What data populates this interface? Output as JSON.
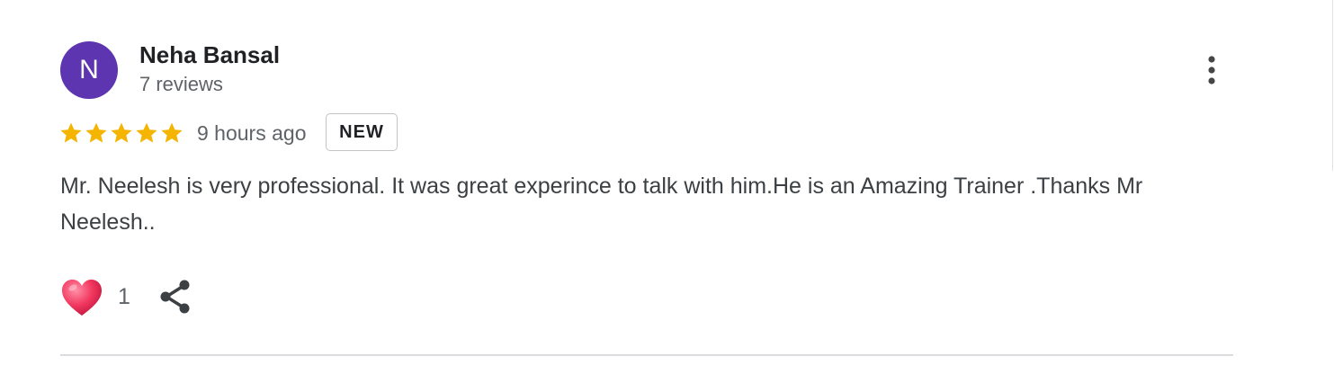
{
  "review": {
    "author": {
      "initial": "N",
      "name": "Neha Bansal",
      "reviews_count": "7 reviews",
      "avatar_color": "#5e35b1"
    },
    "rating": 5,
    "rating_max": 5,
    "time_ago": "9 hours ago",
    "badge": "NEW",
    "text": "Mr. Neelesh is very professional. It was great experince to talk with him.He is an Amazing Trainer .Thanks Mr Neelesh..",
    "like_count": "1",
    "icons": {
      "menu": "more-vert-icon",
      "like": "heart-icon",
      "share": "share-icon",
      "star": "star-icon"
    }
  },
  "colors": {
    "star": "#f4b400",
    "heart": "#e8335a",
    "badge_border": "#c4c4c4"
  }
}
